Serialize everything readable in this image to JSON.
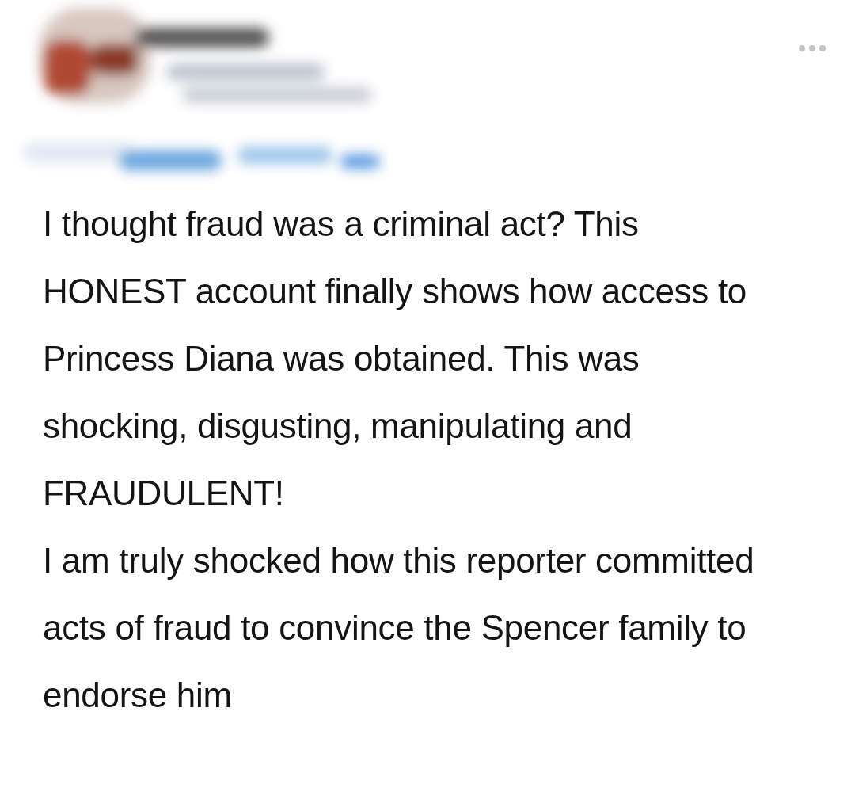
{
  "post": {
    "paragraphs": [
      "I thought fraud was a criminal act? This HONEST account finally shows how access to Princess Diana was obtained. This was shocking, disgusting, manipulating and FRAUDULENT!",
      "I am truly shocked how this reporter committed acts of fraud to convince the Spencer family to endorse him"
    ]
  }
}
